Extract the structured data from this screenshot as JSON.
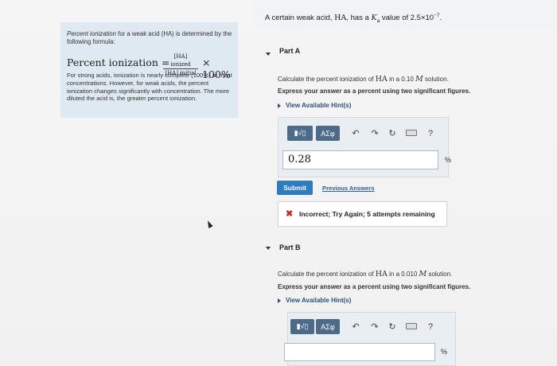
{
  "intro": {
    "text_before": "A certain weak acid, ",
    "acid": "HA",
    "text_mid": ", has a ",
    "k": "K",
    "k_sub": "a",
    "text_after": " value of 2.5×10",
    "exponent": "−7",
    "period": "."
  },
  "info": {
    "p1_italic": "Percent ionization",
    "p1_rest": " for a weak acid (HA) is determined by the following formula:",
    "formula_lhs": "Percent ionization =",
    "formula_num": "[HA] ionized",
    "formula_den": "[HA] initial",
    "formula_rhs": "× 100%",
    "p2": "For strong acids, ionization is nearly complete (100%) at most concentrations. However, for weak acids, the percent ionization changes significantly with concentration. The more diluted the acid is, the greater percent ionization."
  },
  "partA": {
    "title": "Part A",
    "prompt_before": "Calculate the percent ionization of ",
    "acid": "HA",
    "prompt_mid": " in a 0.10 ",
    "unit_M": "M",
    "prompt_after": " solution.",
    "instruction": "Express your answer as a percent using two significant figures.",
    "hints": "View Available Hint(s)",
    "toolbar": {
      "templates": "▮√▯",
      "greek": "ΑΣφ",
      "undo": "↶",
      "redo": "↷",
      "reset": "↻",
      "keyboard": "",
      "help": "?"
    },
    "answer": "0.28",
    "unit": "%",
    "submit": "Submit",
    "previous": "Previous Answers",
    "feedback_icon": "✖",
    "feedback": "Incorrect; Try Again; 5 attempts remaining"
  },
  "partB": {
    "title": "Part B",
    "prompt_before": "Calculate the percent ionization of ",
    "acid": "HA",
    "prompt_mid": " in a 0.010 ",
    "unit_M": "M",
    "prompt_after": " solution.",
    "instruction": "Express your answer as a percent using two significant figures.",
    "hints": "View Available Hint(s)",
    "toolbar": {
      "templates": "▮√▯",
      "greek": "ΑΣφ",
      "undo": "↶",
      "redo": "↷",
      "reset": "↻",
      "keyboard": "",
      "help": "?"
    },
    "answer": "",
    "unit": "%"
  }
}
